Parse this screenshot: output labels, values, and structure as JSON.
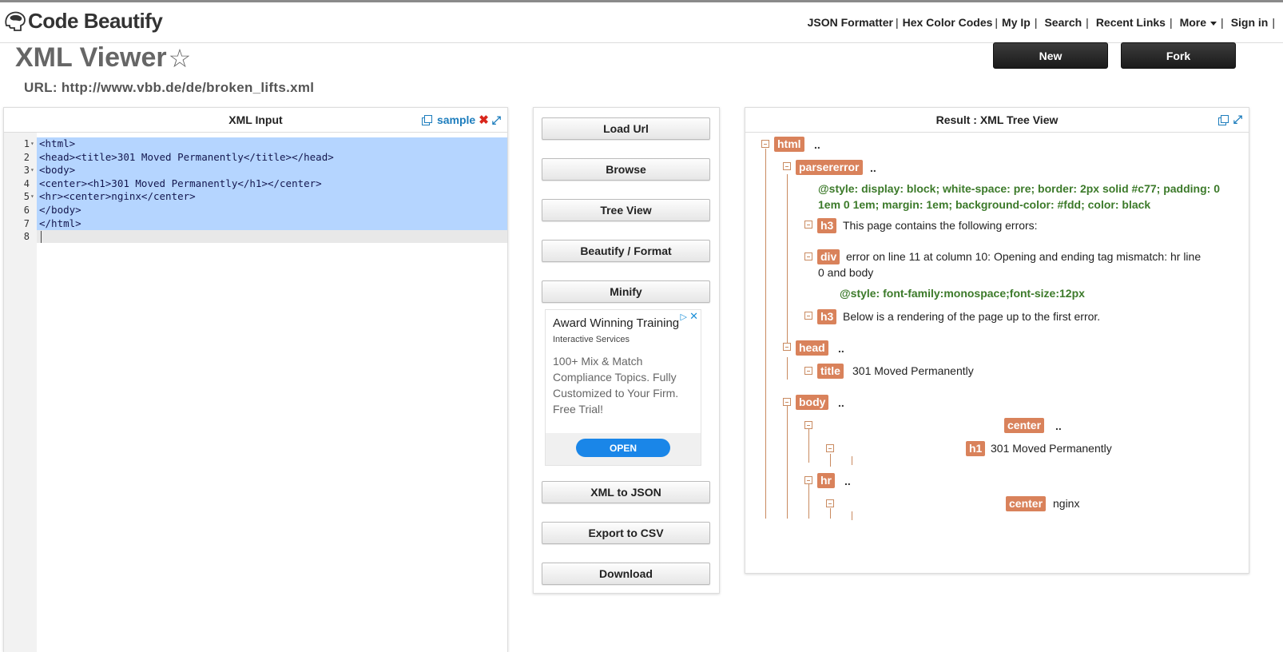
{
  "header": {
    "logo_text": "Code Beautify",
    "nav": [
      "JSON Formatter",
      "Hex Color Codes",
      "My Ip",
      "Search",
      "Recent Links",
      "More",
      "Sign in"
    ]
  },
  "page": {
    "title": "XML Viewer",
    "url_label": "URL: http://www.vbb.de/de/broken_lifts.xml",
    "new_button": "New",
    "fork_button": "Fork"
  },
  "input_panel": {
    "title": "XML Input",
    "sample_label": "sample",
    "close_glyph": "✖",
    "lines": [
      {
        "n": "1",
        "code": "<html>",
        "fold": true
      },
      {
        "n": "2",
        "code": "<head><title>301 Moved Permanently</title></head>",
        "fold": false
      },
      {
        "n": "3",
        "code": "<body>",
        "fold": true
      },
      {
        "n": "4",
        "code": "<center><h1>301 Moved Permanently</h1></center>",
        "fold": false
      },
      {
        "n": "5",
        "code": "<hr><center>nginx</center>",
        "fold": true
      },
      {
        "n": "6",
        "code": "</body>",
        "fold": false
      },
      {
        "n": "7",
        "code": "</html>",
        "fold": false
      },
      {
        "n": "8",
        "code": "",
        "fold": false
      }
    ]
  },
  "actions": {
    "load_url": "Load Url",
    "browse": "Browse",
    "tree_view": "Tree View",
    "beautify": "Beautify / Format",
    "minify": "Minify",
    "xml_to_json": "XML to JSON",
    "export_csv": "Export to CSV",
    "download": "Download"
  },
  "ad": {
    "title": "Award Winning Training",
    "sponsor": "Interactive Services",
    "body": "100+ Mix & Match Compliance Topics. Fully Customized to Your Firm. Free Trial!",
    "cta": "OPEN"
  },
  "result_panel": {
    "title": "Result : XML Tree View",
    "tree": {
      "html": "html",
      "parsererror": "parsererror",
      "style_attr_1a": "@style:  display: block; white-space: pre; border: 2px solid #c77; padding: 0",
      "style_attr_1b": "1em 0 1em; margin: 1em; background-color: #fdd; color: black",
      "h3_a": "h3",
      "h3_a_text": "This page contains the following errors:",
      "div": "div",
      "div_text_a": "error on line 11 at column 10: Opening and ending tag mismatch: hr line",
      "div_text_b": "0 and body",
      "style_attr_2": "@style:  font-family:monospace;font-size:12px",
      "h3_b": "h3",
      "h3_b_text": "Below is a rendering of the page up to the first error.",
      "head": "head",
      "title": "title",
      "title_text": "301 Moved Permanently",
      "body": "body",
      "center_a": "center",
      "h1": "h1",
      "h1_text": "301 Moved Permanently",
      "hr": "hr",
      "center_b": "center",
      "center_b_text": "nginx",
      "dots": ".."
    }
  }
}
